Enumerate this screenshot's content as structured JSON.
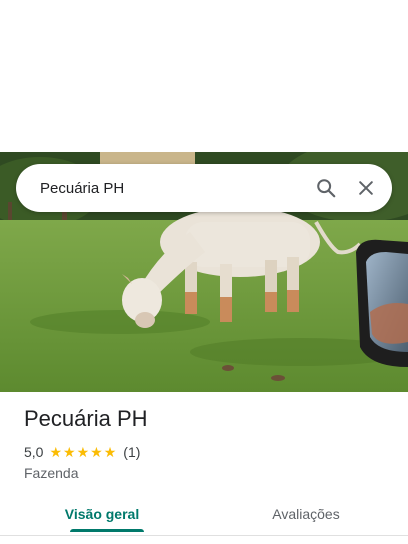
{
  "search": {
    "query": "Pecuária PH",
    "search_icon": "search-icon",
    "close_icon": "close-icon"
  },
  "hero": {
    "subject": "white cow grazing in a green pasture, car side mirror at right edge"
  },
  "place": {
    "name": "Pecuária PH",
    "rating": "5,0",
    "stars": 5,
    "review_count": "(1)",
    "category": "Fazenda"
  },
  "tabs": [
    {
      "label": "Visão geral",
      "active": true
    },
    {
      "label": "Avaliações",
      "active": false
    }
  ],
  "colors": {
    "accent": "#00796b",
    "star": "#fbbc04",
    "text": "#202124"
  }
}
